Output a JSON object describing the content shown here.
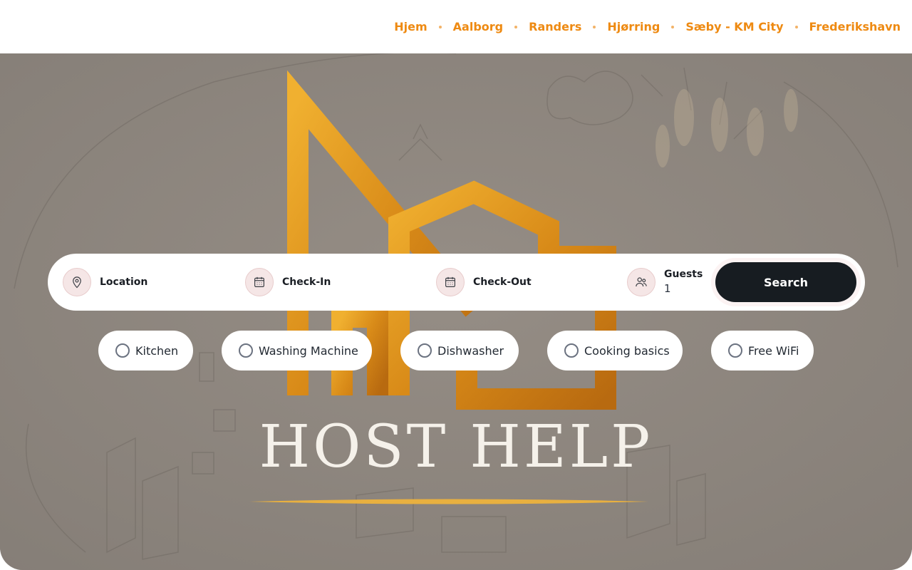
{
  "header": {
    "nav": [
      {
        "label": "Hjem"
      },
      {
        "label": "Aalborg"
      },
      {
        "label": "Randers"
      },
      {
        "label": "Hjørring"
      },
      {
        "label": "Sæby - KM City"
      },
      {
        "label": "Frederikshavn"
      }
    ],
    "accent_color": "#ee8a12"
  },
  "hero": {
    "brand_text": "HOST HELP",
    "logo_color": "#e09a20"
  },
  "search": {
    "location_label": "Location",
    "checkin_label": "Check-In",
    "checkout_label": "Check-Out",
    "guests_label": "Guests",
    "guests_value": "1",
    "button_label": "Search",
    "icons": {
      "location": "map-pin-icon",
      "checkin": "calendar-icon",
      "checkout": "calendar-icon",
      "guests": "users-icon"
    }
  },
  "amenities": [
    {
      "label": "Kitchen",
      "checked": false
    },
    {
      "label": "Washing Machine",
      "checked": false
    },
    {
      "label": "Dishwasher",
      "checked": false
    },
    {
      "label": "Cooking basics",
      "checked": false
    },
    {
      "label": "Free WiFi",
      "checked": false
    }
  ]
}
